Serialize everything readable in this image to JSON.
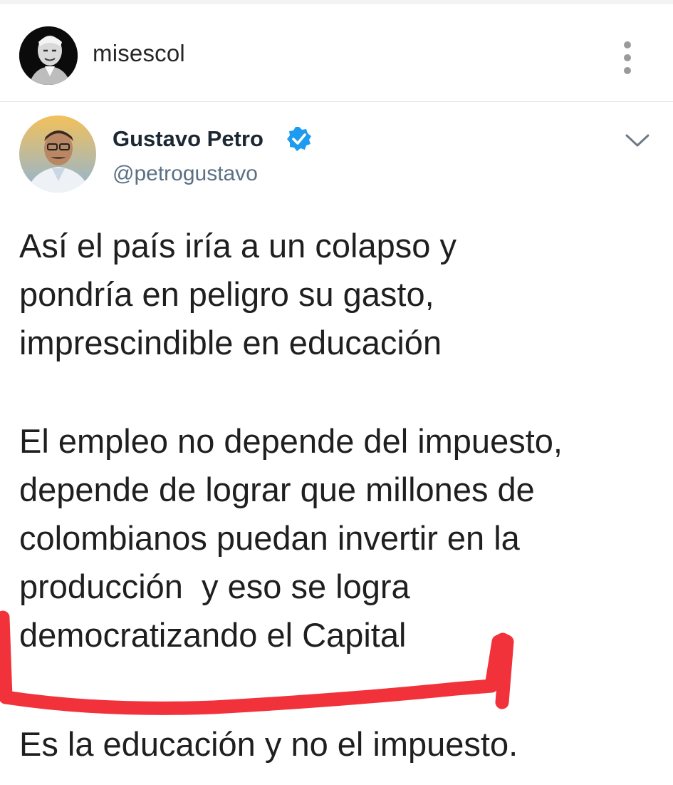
{
  "ig_header": {
    "username": "misescol",
    "avatar_icon": "profile-photo",
    "more_icon": "more-vertical-icon"
  },
  "tweet": {
    "author_name": "Gustavo Petro",
    "handle": "@petrogustavo",
    "verified_icon": "verified-badge-icon",
    "verified_color": "#1d9bf0",
    "menu_icon": "chevron-down-icon",
    "paragraphs": [
      "Así el país iría a un colapso y\npondría en peligro su gasto,\nimprescindible en educación",
      "El empleo no depende del impuesto,\ndepende de lograr que millones de\ncolombianos puedan invertir en la\nproducción  y eso se logra\ndemocratizando el Capital",
      "Es la educación y no el impuesto."
    ]
  },
  "annotation": {
    "underline_color": "#f2323a",
    "underlined_text": "producción  y eso se logra democratizando el Capital"
  }
}
